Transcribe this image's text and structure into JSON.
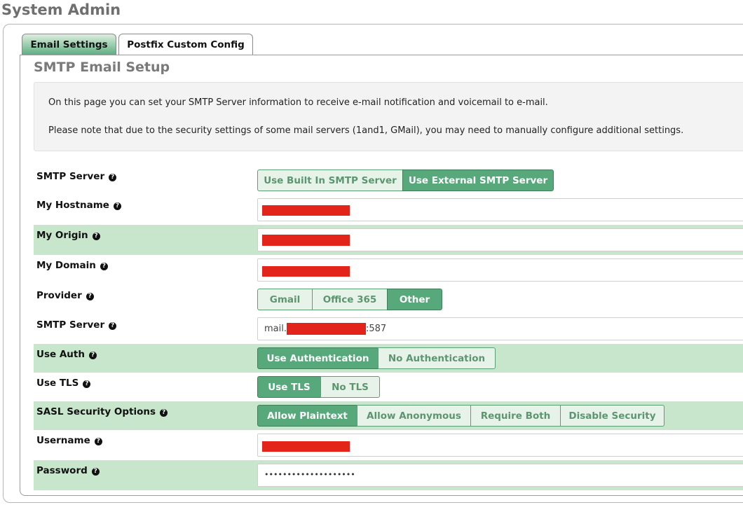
{
  "app": {
    "title": "System Admin"
  },
  "tabs": [
    {
      "label": "Email Settings",
      "active": true
    },
    {
      "label": "Postfix Custom Config",
      "active": false
    }
  ],
  "section": {
    "title": "SMTP Email Setup"
  },
  "info": {
    "line1": "On this page you can set your SMTP Server information to receive e-mail notification and voicemail to e-mail.",
    "line2": "Please note that due to the security settings of some mail servers (1and1, GMail), you may need to manually configure additional settings."
  },
  "help_icon_glyph": "?",
  "form": {
    "smtp_server_mode": {
      "label": "SMTP Server",
      "options": [
        "Use Built In SMTP Server",
        "Use External SMTP Server"
      ],
      "selected": "Use External SMTP Server"
    },
    "my_hostname": {
      "label": "My Hostname",
      "value_redacted": true
    },
    "my_origin": {
      "label": "My Origin",
      "value_redacted": true
    },
    "my_domain": {
      "label": "My Domain",
      "value_redacted": true
    },
    "provider": {
      "label": "Provider",
      "options": [
        "Gmail",
        "Office 365",
        "Other"
      ],
      "selected": "Other"
    },
    "smtp_server_host": {
      "label": "SMTP Server",
      "prefix": "mail.",
      "suffix": ":587",
      "middle_redacted": true
    },
    "use_auth": {
      "label": "Use Auth",
      "options": [
        "Use Authentication",
        "No Authentication"
      ],
      "selected": "Use Authentication"
    },
    "use_tls": {
      "label": "Use TLS",
      "options": [
        "Use TLS",
        "No TLS"
      ],
      "selected": "Use TLS"
    },
    "sasl_security": {
      "label": "SASL Security Options",
      "options": [
        "Allow Plaintext",
        "Allow Anonymous",
        "Require Both",
        "Disable Security"
      ],
      "selected": "Allow Plaintext"
    },
    "username": {
      "label": "Username",
      "value_redacted": true
    },
    "password": {
      "label": "Password",
      "masked_value": "••••••••••••••••••••"
    }
  },
  "colors": {
    "accent": "#57a97b",
    "highlight_row": "#c8e6cb",
    "redaction": "#e3241b"
  }
}
